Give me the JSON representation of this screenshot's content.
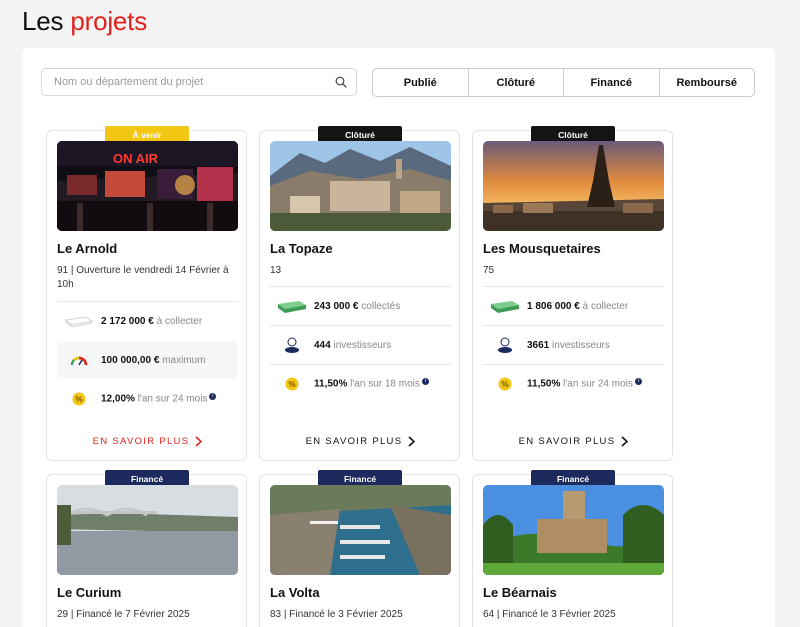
{
  "header": {
    "title_prefix": "Les",
    "title_accent": "projets"
  },
  "search": {
    "placeholder": "Nom ou département du projet"
  },
  "tabs": [
    "Publié",
    "Clôturé",
    "Financé",
    "Remboursé"
  ],
  "colors": {
    "accent": "#e3211c",
    "badge_open": "#f3c613",
    "badge_closed": "#141414",
    "badge_funded": "#1c2a5e"
  },
  "projects": [
    {
      "badge": "À venir",
      "title": "Le Arnold",
      "subtitle": "91 | Ouverture le vendredi 14 Février à 10h",
      "amount_value": "2 172 000 €",
      "amount_label": "à collecter",
      "max_value": "100 000,00 €",
      "max_label": "maximum",
      "rate_value": "12,00%",
      "rate_label": "l'an sur 24 mois",
      "more": "EN SAVOIR PLUS"
    },
    {
      "badge": "Clôturé",
      "title": "La Topaze",
      "subtitle": "13",
      "amount_value": "243 000 €",
      "amount_label": "collectés",
      "investors_value": "444",
      "investors_label": "investisseurs",
      "rate_value": "11,50%",
      "rate_label": "l'an sur 18 mois",
      "more": "EN SAVOIR PLUS"
    },
    {
      "badge": "Clôturé",
      "title": "Les Mousquetaires",
      "subtitle": "75",
      "amount_value": "1 806 000 €",
      "amount_label": "à collecter",
      "investors_value": "3661",
      "investors_label": "investisseurs",
      "rate_value": "11,50%",
      "rate_label": "l'an sur 24 mois",
      "more": "EN SAVOIR PLUS"
    },
    {
      "badge": "Financé",
      "title": "Le Curium",
      "subtitle": "29 | Financé le 7 Février 2025"
    },
    {
      "badge": "Financé",
      "title": "La Volta",
      "subtitle": "83 | Financé le 3 Février 2025"
    },
    {
      "badge": "Financé",
      "title": "Le Béarnais",
      "subtitle": "64 | Financé le 3 Février 2025"
    }
  ]
}
